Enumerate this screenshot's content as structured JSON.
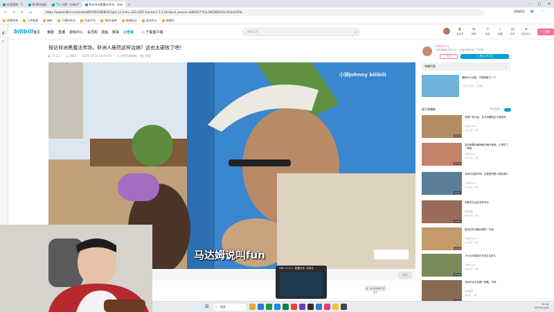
{
  "browser": {
    "tabs": [
      {
        "label": "标签管理 - 1"
      },
      {
        "label": "BiliBili动画"
      },
      {
        "label": "\"Co 卡斯 - bilibili\""
      },
      {
        "label": "探访非洲黑魔法市场，非洲"
      }
    ],
    "url": "https://www.bilibili.com/video/BV1R9518E8ES/?spm_id_from=333.1007.tianma.1-1-1.click&vd_source=dd09257752c3d6382fe01c163e2d35b",
    "bookmarks": [
      "哔哩哔哩",
      "上传视频",
      "稿件",
      "下载Bilibili",
      "开放平台",
      "ToDo清单",
      "微博站点",
      "游戏中心",
      "微博页"
    ],
    "profile_label": "定制网页",
    "ai_label": "AI"
  },
  "site": {
    "logo": "bilibili",
    "nav": [
      "首页",
      "番剧",
      "直播",
      "游戏中心",
      "会员购",
      "漫画",
      "赛事",
      "公告单",
      "下载客户端"
    ],
    "search_placeholder": "帅关大万",
    "header_icons": [
      "大会员",
      "消息",
      "动态",
      "收藏",
      "历史",
      "创作中心"
    ],
    "upload_label": "投稿"
  },
  "video": {
    "title": "探访非洲黑魔法市场，非洲人居然这样治病？这也太硬核了吧！",
    "meta": [
      "14.2万",
      "2864",
      "2024-10-30 18:00:00",
      "未经作者授权，禁止转载"
    ],
    "caption": "马达姆说叫fun",
    "watermark": "小钟Johnny bilibili",
    "danmaku_placeholder": "发个友善的弹幕见证当下",
    "send_label": "发送"
  },
  "sidebar": {
    "up_name": "小钟Johnny",
    "up_desc": "一名热爱旅行的UP主，走遍世界的每一个角落",
    "charge_label": "充电",
    "follow_label": "+ 关注 69.3万",
    "danmaku_list_label": "弹幕列表",
    "ad": {
      "title": "最新什么功能，不想再做下一个",
      "sub": "十万个为什么 · 不可能"
    },
    "next_label": "接下来播放",
    "autoplay_label": "自动连播",
    "recommendations": [
      {
        "title": "穷国广西大桂，在非洲撒哈拉沙漠卖鸡",
        "up": "小钟Johnny",
        "stats": "366.6万 · 3月",
        "duration": "30:22"
      },
      {
        "title": "探访刚果河最神秘的渔村家庭，小哥买了一条鱼",
        "up": "小钟Johnny",
        "stats": "432.5万 · 2月",
        "duration": "20:23"
      },
      {
        "title": "非洲马拉维市场，这里居然是人类的源头",
        "up": "小钟Johnny",
        "stats": "136.3万 · 1月",
        "duration": "33:01"
      },
      {
        "title": "花数字生活比没有你长",
        "up": "双鱼爸爸",
        "stats": "102.5万 · 1月",
        "duration": "06:00"
      },
      {
        "title": "挑战在非洲路边摊吃一天饭",
        "up": "小钟Johnny",
        "stats": "294.5万 · 2月",
        "duration": "27:16"
      },
      {
        "title": "100万存款能在非洲生活多久",
        "up": "小钟Johnny",
        "stats": "336.1万 · 5月",
        "duration": "30:02"
      },
      {
        "title": "非洲市乡贝尼娜一嗯要，不快",
        "up": "有效推荐",
        "stats": "46.4万 · 5月",
        "duration": "32:31"
      }
    ]
  },
  "popup": {
    "title": "OBS 31.0.2 - 配置文件: 未命名"
  },
  "taskbar": {
    "search_label": "搜索",
    "time": "10:18",
    "date": "2025/11/28"
  }
}
